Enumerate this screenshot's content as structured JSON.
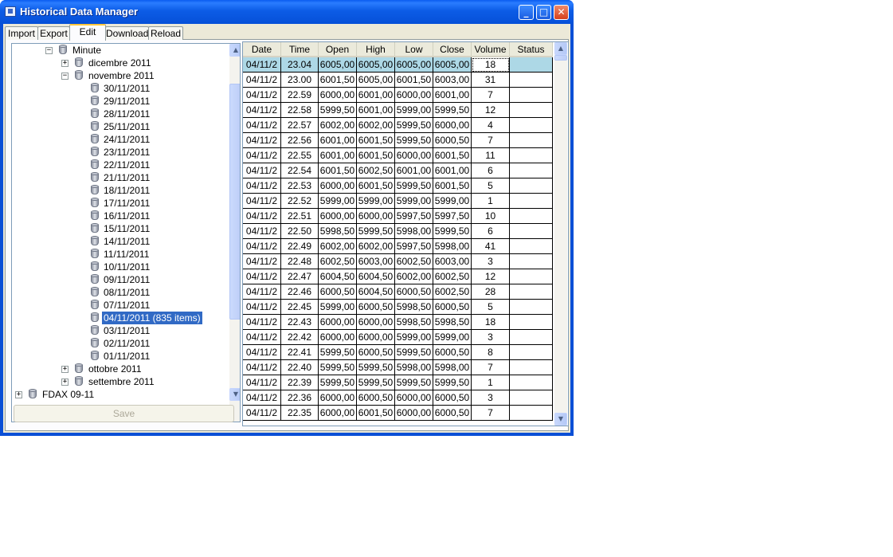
{
  "window": {
    "title": "Historical Data Manager",
    "min": "_",
    "max": "□",
    "close": "✕"
  },
  "tabs": [
    {
      "label": "Import",
      "active": false
    },
    {
      "label": "Export",
      "active": false
    },
    {
      "label": "Edit",
      "active": true
    },
    {
      "label": "Download",
      "active": false
    },
    {
      "label": "Reload",
      "active": false
    }
  ],
  "tree": {
    "nodes": [
      {
        "label": "Minute",
        "level": 1,
        "expander": "−",
        "selected": false
      },
      {
        "label": "dicembre 2011",
        "level": 2,
        "expander": "+",
        "selected": false
      },
      {
        "label": "novembre 2011",
        "level": 2,
        "expander": "−",
        "selected": false
      },
      {
        "label": "30/11/2011",
        "level": 3,
        "expander": "",
        "selected": false
      },
      {
        "label": "29/11/2011",
        "level": 3,
        "expander": "",
        "selected": false
      },
      {
        "label": "28/11/2011",
        "level": 3,
        "expander": "",
        "selected": false
      },
      {
        "label": "25/11/2011",
        "level": 3,
        "expander": "",
        "selected": false
      },
      {
        "label": "24/11/2011",
        "level": 3,
        "expander": "",
        "selected": false
      },
      {
        "label": "23/11/2011",
        "level": 3,
        "expander": "",
        "selected": false
      },
      {
        "label": "22/11/2011",
        "level": 3,
        "expander": "",
        "selected": false
      },
      {
        "label": "21/11/2011",
        "level": 3,
        "expander": "",
        "selected": false
      },
      {
        "label": "18/11/2011",
        "level": 3,
        "expander": "",
        "selected": false
      },
      {
        "label": "17/11/2011",
        "level": 3,
        "expander": "",
        "selected": false
      },
      {
        "label": "16/11/2011",
        "level": 3,
        "expander": "",
        "selected": false
      },
      {
        "label": "15/11/2011",
        "level": 3,
        "expander": "",
        "selected": false
      },
      {
        "label": "14/11/2011",
        "level": 3,
        "expander": "",
        "selected": false
      },
      {
        "label": "11/11/2011",
        "level": 3,
        "expander": "",
        "selected": false
      },
      {
        "label": "10/11/2011",
        "level": 3,
        "expander": "",
        "selected": false
      },
      {
        "label": "09/11/2011",
        "level": 3,
        "expander": "",
        "selected": false
      },
      {
        "label": "08/11/2011",
        "level": 3,
        "expander": "",
        "selected": false
      },
      {
        "label": "07/11/2011",
        "level": 3,
        "expander": "",
        "selected": false
      },
      {
        "label": "04/11/2011 (835 items)",
        "level": 3,
        "expander": "",
        "selected": true
      },
      {
        "label": "03/11/2011",
        "level": 3,
        "expander": "",
        "selected": false
      },
      {
        "label": "02/11/2011",
        "level": 3,
        "expander": "",
        "selected": false
      },
      {
        "label": "01/11/2011",
        "level": 3,
        "expander": "",
        "selected": false
      },
      {
        "label": "ottobre 2011",
        "level": 2,
        "expander": "+",
        "selected": false
      },
      {
        "label": "settembre 2011",
        "level": 2,
        "expander": "+",
        "selected": false
      },
      {
        "label": "FDAX 09-11",
        "level": 0,
        "expander": "+",
        "selected": false
      }
    ]
  },
  "save_label": "Save",
  "grid": {
    "columns": [
      "Date",
      "Time",
      "Open",
      "High",
      "Low",
      "Close",
      "Volume",
      "Status"
    ],
    "rows": [
      [
        "04/11/2",
        "23.04",
        "6005,00",
        "6005,00",
        "6005,00",
        "6005,00",
        "18",
        ""
      ],
      [
        "04/11/2",
        "23.00",
        "6001,50",
        "6005,00",
        "6001,50",
        "6003,00",
        "31",
        ""
      ],
      [
        "04/11/2",
        "22.59",
        "6000,00",
        "6001,00",
        "6000,00",
        "6001,00",
        "7",
        ""
      ],
      [
        "04/11/2",
        "22.58",
        "5999,50",
        "6001,00",
        "5999,00",
        "5999,50",
        "12",
        ""
      ],
      [
        "04/11/2",
        "22.57",
        "6002,00",
        "6002,00",
        "5999,50",
        "6000,00",
        "4",
        ""
      ],
      [
        "04/11/2",
        "22.56",
        "6001,00",
        "6001,50",
        "5999,50",
        "6000,50",
        "7",
        ""
      ],
      [
        "04/11/2",
        "22.55",
        "6001,00",
        "6001,50",
        "6000,00",
        "6001,50",
        "11",
        ""
      ],
      [
        "04/11/2",
        "22.54",
        "6001,50",
        "6002,50",
        "6001,00",
        "6001,00",
        "6",
        ""
      ],
      [
        "04/11/2",
        "22.53",
        "6000,00",
        "6001,50",
        "5999,50",
        "6001,50",
        "5",
        ""
      ],
      [
        "04/11/2",
        "22.52",
        "5999,00",
        "5999,00",
        "5999,00",
        "5999,00",
        "1",
        ""
      ],
      [
        "04/11/2",
        "22.51",
        "6000,00",
        "6000,00",
        "5997,50",
        "5997,50",
        "10",
        ""
      ],
      [
        "04/11/2",
        "22.50",
        "5998,50",
        "5999,50",
        "5998,00",
        "5999,50",
        "6",
        ""
      ],
      [
        "04/11/2",
        "22.49",
        "6002,00",
        "6002,00",
        "5997,50",
        "5998,00",
        "41",
        ""
      ],
      [
        "04/11/2",
        "22.48",
        "6002,50",
        "6003,00",
        "6002,50",
        "6003,00",
        "3",
        ""
      ],
      [
        "04/11/2",
        "22.47",
        "6004,50",
        "6004,50",
        "6002,00",
        "6002,50",
        "12",
        ""
      ],
      [
        "04/11/2",
        "22.46",
        "6000,50",
        "6004,50",
        "6000,50",
        "6002,50",
        "28",
        ""
      ],
      [
        "04/11/2",
        "22.45",
        "5999,00",
        "6000,50",
        "5998,50",
        "6000,50",
        "5",
        ""
      ],
      [
        "04/11/2",
        "22.43",
        "6000,00",
        "6000,00",
        "5998,50",
        "5998,50",
        "18",
        ""
      ],
      [
        "04/11/2",
        "22.42",
        "6000,00",
        "6000,00",
        "5999,00",
        "5999,00",
        "3",
        ""
      ],
      [
        "04/11/2",
        "22.41",
        "5999,50",
        "6000,50",
        "5999,50",
        "6000,50",
        "8",
        ""
      ],
      [
        "04/11/2",
        "22.40",
        "5999,50",
        "5999,50",
        "5998,00",
        "5998,00",
        "7",
        ""
      ],
      [
        "04/11/2",
        "22.39",
        "5999,50",
        "5999,50",
        "5999,50",
        "5999,50",
        "1",
        ""
      ],
      [
        "04/11/2",
        "22.36",
        "6000,00",
        "6000,50",
        "6000,00",
        "6000,50",
        "3",
        ""
      ],
      [
        "04/11/2",
        "22.35",
        "6000,00",
        "6001,50",
        "6000,00",
        "6000,50",
        "7",
        ""
      ]
    ],
    "selected_row": 0
  },
  "scroll_arrows": {
    "up": "▲",
    "down": "▼"
  }
}
